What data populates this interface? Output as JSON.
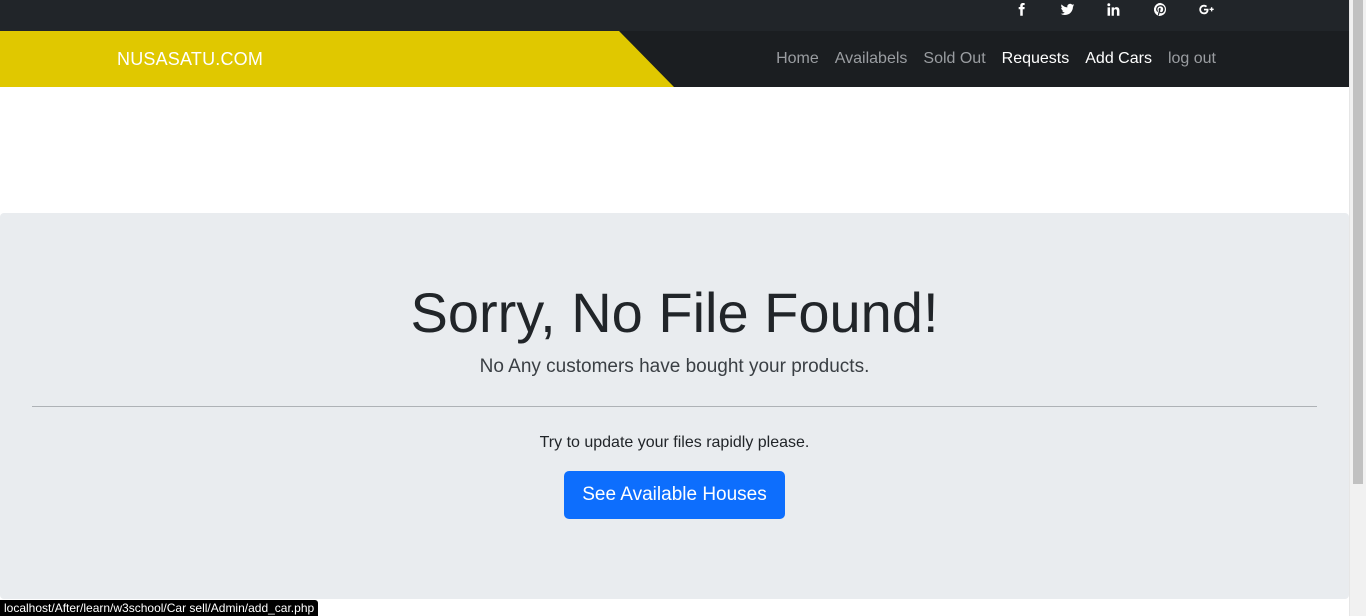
{
  "social": {
    "icons": [
      "facebook-icon",
      "twitter-icon",
      "linkedin-icon",
      "pinterest-icon",
      "google-plus-icon"
    ]
  },
  "navbar": {
    "brand": "NUSASATU.COM",
    "brand_color": "#e0c800",
    "links": [
      {
        "label": "Home",
        "active": false
      },
      {
        "label": "Availabels",
        "active": false
      },
      {
        "label": "Sold Out",
        "active": false
      },
      {
        "label": "Requests",
        "active": true
      },
      {
        "label": "Add Cars",
        "active": true
      },
      {
        "label": "log out",
        "active": false
      }
    ]
  },
  "jumbotron": {
    "title": "Sorry, No File Found!",
    "lead": "No Any customers have bought your products.",
    "text": "Try to update your files rapidly please.",
    "button_label": "See Available Houses",
    "button_color": "#0d6efd"
  },
  "status_bar": {
    "url": "localhost/After/learn/w3school/Car sell/Admin/add_car.php"
  }
}
